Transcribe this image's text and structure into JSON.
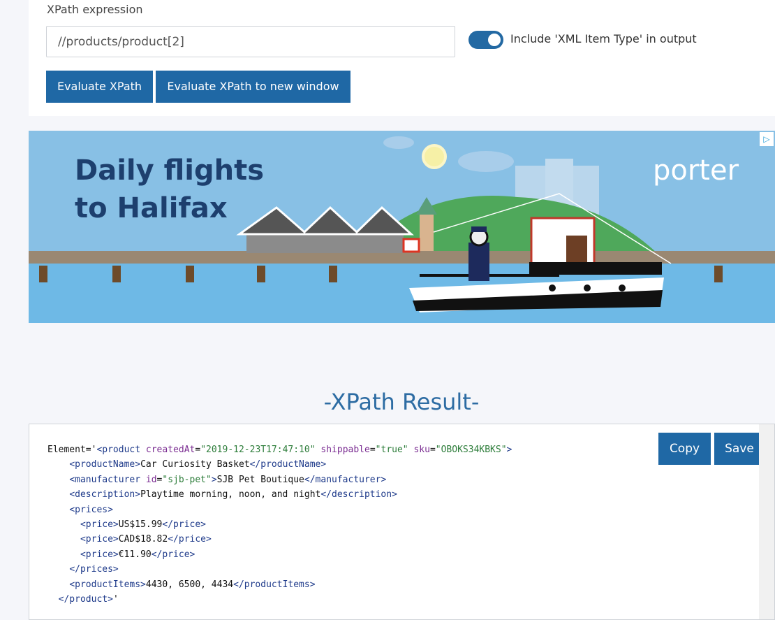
{
  "form": {
    "label": "XPath expression",
    "input_value": "//products/product[2]",
    "toggle_label": "Include 'XML Item Type' in output",
    "toggle_on": true,
    "evaluate_label": "Evaluate XPath",
    "evaluate_new_label": "Evaluate XPath to new window"
  },
  "ad": {
    "headline_line1": "Daily flights",
    "headline_line2": "to Halifax",
    "brand": "porter",
    "badge": "▷"
  },
  "result": {
    "title": "-XPath Result-",
    "copy_label": "Copy",
    "save_label": "Save",
    "lines": [
      {
        "indent": "",
        "parts": [
          [
            "t",
            "Element='"
          ],
          [
            "tag",
            "<product"
          ],
          [
            "t",
            " "
          ],
          [
            "attr",
            "createdAt"
          ],
          [
            "t",
            "="
          ],
          [
            "val",
            "\"2019-12-23T17:47:10\""
          ],
          [
            "t",
            " "
          ],
          [
            "attr",
            "shippable"
          ],
          [
            "t",
            "="
          ],
          [
            "val",
            "\"true\""
          ],
          [
            "t",
            " "
          ],
          [
            "attr",
            "sku"
          ],
          [
            "t",
            "="
          ],
          [
            "val",
            "\"OBOKS34KBKS\""
          ],
          [
            "tag",
            ">"
          ]
        ]
      },
      {
        "indent": "    ",
        "parts": [
          [
            "tag",
            "<productName>"
          ],
          [
            "t",
            "Car Curiosity Basket"
          ],
          [
            "tag",
            "</productName>"
          ]
        ]
      },
      {
        "indent": "    ",
        "parts": [
          [
            "tag",
            "<manufacturer"
          ],
          [
            "t",
            " "
          ],
          [
            "attr",
            "id"
          ],
          [
            "t",
            "="
          ],
          [
            "val",
            "\"sjb-pet\""
          ],
          [
            "tag",
            ">"
          ],
          [
            "t",
            "SJB Pet Boutique"
          ],
          [
            "tag",
            "</manufacturer>"
          ]
        ]
      },
      {
        "indent": "    ",
        "parts": [
          [
            "tag",
            "<description>"
          ],
          [
            "t",
            "Playtime morning, noon, and night"
          ],
          [
            "tag",
            "</description>"
          ]
        ]
      },
      {
        "indent": "    ",
        "parts": [
          [
            "tag",
            "<prices>"
          ]
        ]
      },
      {
        "indent": "      ",
        "parts": [
          [
            "tag",
            "<price>"
          ],
          [
            "t",
            "US$15.99"
          ],
          [
            "tag",
            "</price>"
          ]
        ]
      },
      {
        "indent": "      ",
        "parts": [
          [
            "tag",
            "<price>"
          ],
          [
            "t",
            "CAD$18.82"
          ],
          [
            "tag",
            "</price>"
          ]
        ]
      },
      {
        "indent": "      ",
        "parts": [
          [
            "tag",
            "<price>"
          ],
          [
            "t",
            "€11.90"
          ],
          [
            "tag",
            "</price>"
          ]
        ]
      },
      {
        "indent": "    ",
        "parts": [
          [
            "tag",
            "</prices>"
          ]
        ]
      },
      {
        "indent": "    ",
        "parts": [
          [
            "tag",
            "<productItems>"
          ],
          [
            "t",
            "4430, 6500, 4434"
          ],
          [
            "tag",
            "</productItems>"
          ]
        ]
      },
      {
        "indent": "  ",
        "parts": [
          [
            "tag",
            "</product>"
          ],
          [
            "t",
            "'"
          ]
        ]
      }
    ]
  }
}
